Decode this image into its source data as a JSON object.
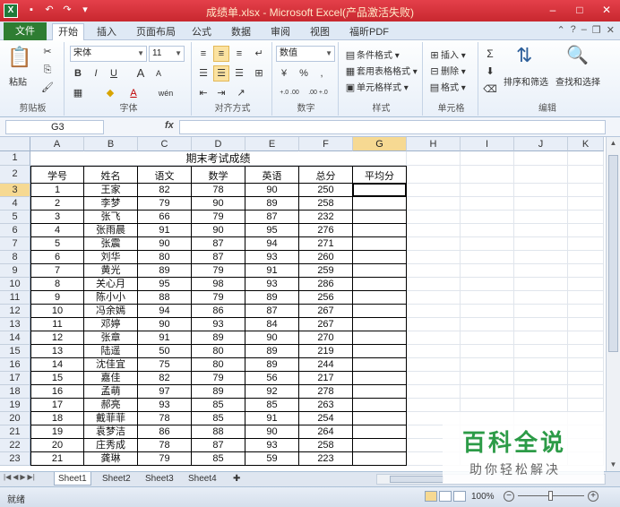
{
  "window": {
    "title": "成绩单.xlsx - Microsoft Excel(产品激活失败)",
    "app_icon_letter": "X"
  },
  "ribbon_tabs": {
    "file": "文件",
    "tabs": [
      "开始",
      "插入",
      "页面布局",
      "公式",
      "数据",
      "审阅",
      "视图",
      "福昕PDF"
    ],
    "active": "开始"
  },
  "ribbon": {
    "clipboard": {
      "paste": "粘贴",
      "label": "剪贴板"
    },
    "font": {
      "name": "宋体",
      "size": "11",
      "label": "字体",
      "bold": "B",
      "italic": "I",
      "underline": "U",
      "grow": "A",
      "shrink": "A",
      "color_letter": "A",
      "phonetic": "wén"
    },
    "alignment": {
      "label": "对齐方式"
    },
    "number": {
      "format": "数值",
      "label": "数字",
      "percent": "%",
      "comma": ",",
      "dec_inc": "+.0 .00",
      "dec_dec": ".00 +.0"
    },
    "styles": {
      "conditional": "条件格式",
      "table": "套用表格格式",
      "cell": "单元格样式",
      "label": "样式"
    },
    "cells": {
      "insert": "插入",
      "delete": "删除",
      "format": "格式",
      "label": "单元格"
    },
    "editing": {
      "sort": "排序和筛选",
      "find": "查找和选择",
      "label": "编辑",
      "sum": "Σ"
    }
  },
  "formula_bar": {
    "name_box": "G3",
    "fx": "fx",
    "value": ""
  },
  "columns": [
    "A",
    "B",
    "C",
    "D",
    "E",
    "F",
    "G",
    "H",
    "I",
    "J",
    "K"
  ],
  "selected_column": "G",
  "selected_row": 3,
  "rows": [
    "1",
    "2",
    "3",
    "4",
    "5",
    "6",
    "7",
    "8",
    "9",
    "10",
    "11",
    "12",
    "13",
    "14",
    "15",
    "16",
    "17",
    "18",
    "19",
    "20",
    "21",
    "22",
    "23"
  ],
  "sheet": {
    "title": "期末考试成绩",
    "headers": [
      "学号",
      "姓名",
      "语文",
      "数学",
      "英语",
      "总分",
      "平均分"
    ],
    "records": [
      [
        "1",
        "王家",
        "82",
        "78",
        "90",
        "250",
        ""
      ],
      [
        "2",
        "李梦",
        "79",
        "90",
        "89",
        "258",
        ""
      ],
      [
        "3",
        "张飞",
        "66",
        "79",
        "87",
        "232",
        ""
      ],
      [
        "4",
        "张雨晨",
        "91",
        "90",
        "95",
        "276",
        ""
      ],
      [
        "5",
        "张震",
        "90",
        "87",
        "94",
        "271",
        ""
      ],
      [
        "6",
        "刘华",
        "80",
        "87",
        "93",
        "260",
        ""
      ],
      [
        "7",
        "黄光",
        "89",
        "79",
        "91",
        "259",
        ""
      ],
      [
        "8",
        "关心月",
        "95",
        "98",
        "93",
        "286",
        ""
      ],
      [
        "9",
        "陈小小",
        "88",
        "79",
        "89",
        "256",
        ""
      ],
      [
        "10",
        "冯余嫣",
        "94",
        "86",
        "87",
        "267",
        ""
      ],
      [
        "11",
        "邓婷",
        "90",
        "93",
        "84",
        "267",
        ""
      ],
      [
        "12",
        "张章",
        "91",
        "89",
        "90",
        "270",
        ""
      ],
      [
        "13",
        "陆遥",
        "50",
        "80",
        "89",
        "219",
        ""
      ],
      [
        "14",
        "沈佳宜",
        "75",
        "80",
        "89",
        "244",
        ""
      ],
      [
        "15",
        "嘉佳",
        "82",
        "79",
        "56",
        "217",
        ""
      ],
      [
        "16",
        "孟萌",
        "97",
        "89",
        "92",
        "278",
        ""
      ],
      [
        "17",
        "郝亮",
        "93",
        "85",
        "85",
        "263",
        ""
      ],
      [
        "18",
        "戴菲菲",
        "78",
        "85",
        "91",
        "254",
        ""
      ],
      [
        "19",
        "袁梦洁",
        "86",
        "88",
        "90",
        "264",
        ""
      ],
      [
        "20",
        "庄秀成",
        "78",
        "87",
        "93",
        "258",
        ""
      ],
      [
        "21",
        "龚琳",
        "79",
        "85",
        "59",
        "223",
        ""
      ]
    ]
  },
  "sheet_tabs": [
    "Sheet1",
    "Sheet2",
    "Sheet3",
    "Sheet4"
  ],
  "active_sheet": "Sheet1",
  "status": {
    "ready": "就绪",
    "zoom": "100%"
  },
  "watermark": {
    "title": "百科全说",
    "subtitle": "助你轻松解决"
  },
  "colors": {
    "titlebar": "#c8282f",
    "file_tab": "#2e7d32",
    "selection": "#f6d992",
    "watermark_green": "#2c9b47"
  }
}
